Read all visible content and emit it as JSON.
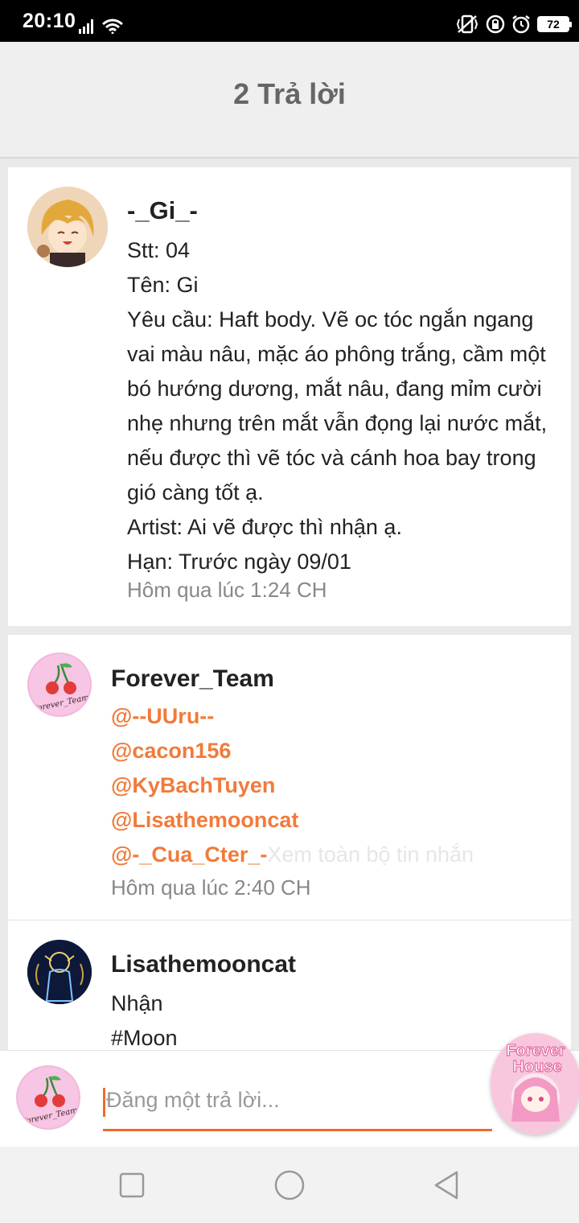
{
  "status_bar": {
    "time": "20:10",
    "battery": "72"
  },
  "header": {
    "title": "2 Trả lời"
  },
  "post": {
    "username": "-_Gi_-",
    "lines": [
      "Stt: 04",
      "Tên: Gi",
      "Yêu cầu: Haft body. Vẽ oc tóc ngắn ngang vai màu nâu, mặc áo phông trắng, cầm một bó hướng dương, mắt nâu, đang mỉm cười nhẹ nhưng trên mắt vẫn đọng lại nước mắt, nếu được thì vẽ tóc và cánh hoa bay trong gió càng tốt ạ.",
      "Artist: Ai vẽ được thì nhận ạ.",
      "Hạn: Trước ngày 09/01"
    ],
    "time": "Hôm qua lúc 1:24 CH"
  },
  "replies": [
    {
      "username": "Forever_Team",
      "mentions": [
        "@--UUru--",
        "@cacon156",
        "@KyBachTuyen",
        "@Lisathemooncat",
        "@-_Cua_Cter_-"
      ],
      "see_all": "Xem toàn bộ tin nhắn",
      "time": "Hôm qua lúc 2:40 CH",
      "avatar_text": "Forever_Team"
    },
    {
      "username": "Lisathemooncat",
      "lines": [
        "Nhận",
        "#Moon"
      ]
    }
  ],
  "compose": {
    "placeholder": "Đăng một trả lời...",
    "avatar_text": "Forever_Team"
  },
  "fab": {
    "line1": "Forever",
    "line2": "House"
  },
  "colors": {
    "accent": "#f27a3a",
    "underline": "#f26a2a"
  }
}
